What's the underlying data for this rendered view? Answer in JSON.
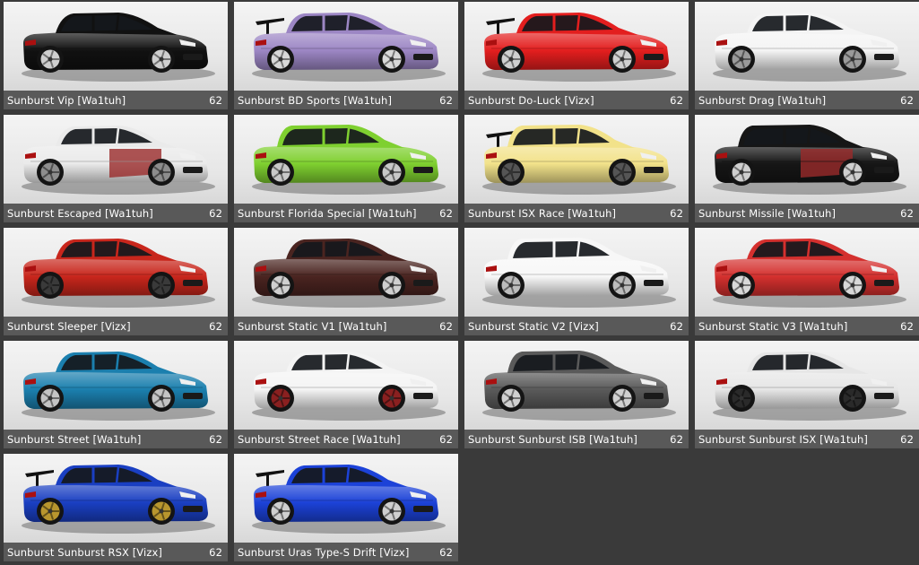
{
  "vehicles": [
    {
      "name": "Sunburst Vip [Wa1tuh]",
      "count": "62",
      "color": "#111111",
      "wheel": "#cfcfcf",
      "variant": "sedan"
    },
    {
      "name": "Sunburst BD Sports [Wa1tuh]",
      "count": "62",
      "color": "#9c86c4",
      "wheel": "#d8d8d8",
      "variant": "sedan-wing"
    },
    {
      "name": "Sunburst Do-Luck [Vizx]",
      "count": "62",
      "color": "#e31e1e",
      "wheel": "#cfcfcf",
      "variant": "sedan-wing"
    },
    {
      "name": "Sunburst Drag [Wa1tuh]",
      "count": "62",
      "color": "#f4f4f4",
      "wheel": "#9a9a9a",
      "variant": "sedan"
    },
    {
      "name": "Sunburst Escaped [Wa1tuh]",
      "count": "62",
      "color": "#eaeaea",
      "wheel": "#8d8d8d",
      "variant": "sedan-patch"
    },
    {
      "name": "Sunburst Florida Special [Wa1tuh]",
      "count": "62",
      "color": "#7fd030",
      "wheel": "#c8c8c8",
      "variant": "hatch"
    },
    {
      "name": "Sunburst ISX Race [Wa1tuh]",
      "count": "62",
      "color": "#f2e28a",
      "wheel": "#555555",
      "variant": "hatch-wing"
    },
    {
      "name": "Sunburst Missile [Wa1tuh]",
      "count": "62",
      "color": "#161616",
      "wheel": "#cfcfcf",
      "variant": "hatch-patch"
    },
    {
      "name": "Sunburst Sleeper [Vizx]",
      "count": "62",
      "color": "#c8261c",
      "wheel": "#3a3a3a",
      "variant": "sedan"
    },
    {
      "name": "Sunburst Static V1 [Wa1tuh]",
      "count": "62",
      "color": "#4a2420",
      "wheel": "#d0d0d0",
      "variant": "sedan"
    },
    {
      "name": "Sunburst Static V2 [Vizx]",
      "count": "62",
      "color": "#f7f7f7",
      "wheel": "#bcbcbc",
      "variant": "hatch"
    },
    {
      "name": "Sunburst Static V3 [Wa1tuh]",
      "count": "62",
      "color": "#d4302e",
      "wheel": "#d8d8d8",
      "variant": "sedan"
    },
    {
      "name": "Sunburst Street [Wa1tuh]",
      "count": "62",
      "color": "#1b7fae",
      "wheel": "#c4c4c4",
      "variant": "sedan"
    },
    {
      "name": "Sunburst Street Race [Wa1tuh]",
      "count": "62",
      "color": "#f4f4f4",
      "wheel": "#8a2020",
      "variant": "sedan"
    },
    {
      "name": "Sunburst Sunburst ISB [Wa1tuh]",
      "count": "62",
      "color": "#5a5a5a",
      "wheel": "#d0d0d0",
      "variant": "hatch"
    },
    {
      "name": "Sunburst Sunburst ISX [Wa1tuh]",
      "count": "62",
      "color": "#e6e6e6",
      "wheel": "#2a2a2a",
      "variant": "sedan"
    },
    {
      "name": "Sunburst Sunburst RSX [Vizx]",
      "count": "62",
      "color": "#1a3fc2",
      "wheel": "#b8962e",
      "variant": "sedan-wing"
    },
    {
      "name": "Sunburst Uras Type-S Drift [Vizx]",
      "count": "62",
      "color": "#1c42d8",
      "wheel": "#cfcfcf",
      "variant": "sedan-wing"
    }
  ]
}
